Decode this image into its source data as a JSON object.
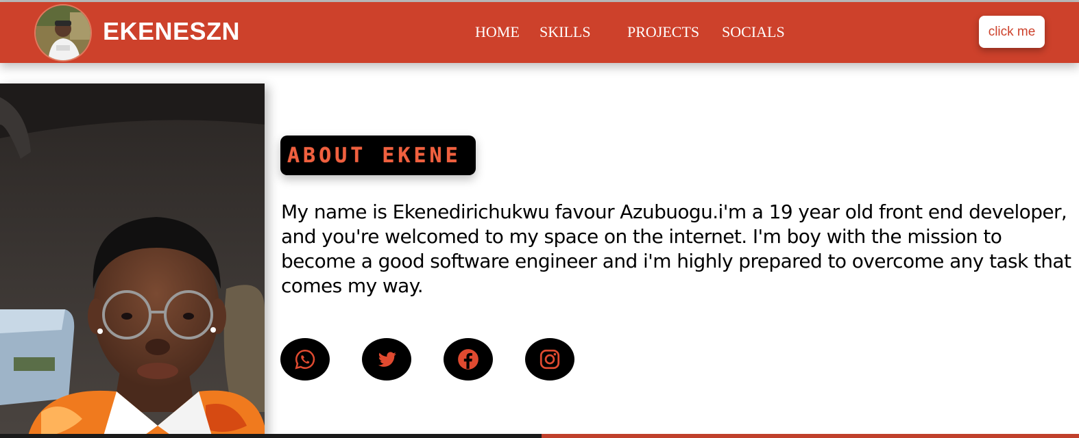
{
  "header": {
    "brand": "EKENESZN",
    "nav": [
      {
        "label": "HOME"
      },
      {
        "label": "SKILLS"
      },
      {
        "label": "PROJECTS"
      },
      {
        "label": "SOCIALS"
      }
    ],
    "cta_label": "click me"
  },
  "about": {
    "heading": "ABOUT EKENE",
    "bio": "My name is Ekenedirichukwu favour Azubuogu.i'm a 19 year old front end developer, and you're welcomed to my space on the internet. I'm boy with the mission to become a good software engineer and i'm highly prepared to overcome any task that comes my way."
  },
  "socials": [
    {
      "icon": "whatsapp-icon"
    },
    {
      "icon": "twitter-icon"
    },
    {
      "icon": "facebook-icon"
    },
    {
      "icon": "instagram-icon"
    }
  ],
  "colors": {
    "brand": "#cd412b",
    "accent_text": "#f0603f",
    "dark": "#000000"
  }
}
